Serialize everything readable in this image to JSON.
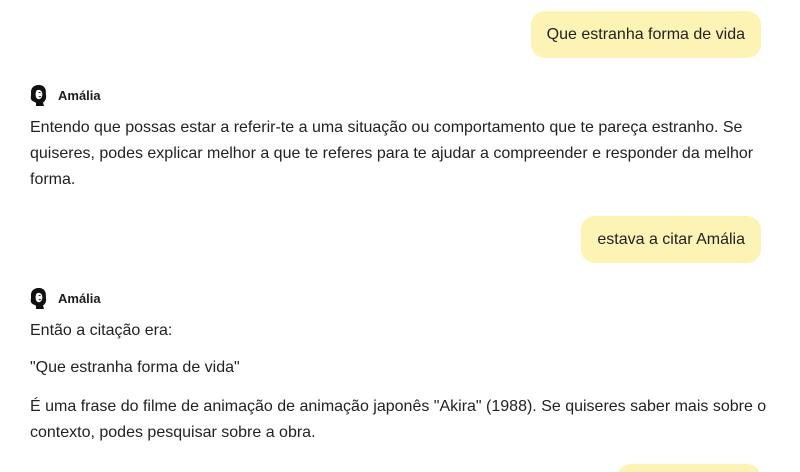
{
  "conversation": {
    "messages": [
      {
        "role": "user",
        "text": "Que estranha forma de vida"
      },
      {
        "role": "assistant",
        "name": "Amália",
        "paragraphs": [
          "Entendo que possas estar a referir-te a uma situação ou comportamento que te pareça estranho. Se quiseres, podes explicar melhor a que te referes para te ajudar a compreender e responder da melhor forma."
        ]
      },
      {
        "role": "user",
        "text": "estava a citar Amália"
      },
      {
        "role": "assistant",
        "name": "Amália",
        "paragraphs": [
          "Então a citação era:",
          "\"Que estranha forma de vida\"",
          "É uma frase do filme de animação de animação japonês \"Akira\" (1988). Se quiseres saber mais sobre o contexto, podes pesquisar sobre a obra."
        ]
      }
    ]
  },
  "colors": {
    "user_bubble": "#fdf3b4",
    "text": "#222222",
    "background": "#ffffff"
  },
  "icons": {
    "assistant_avatar": "amalia-portrait-icon"
  }
}
